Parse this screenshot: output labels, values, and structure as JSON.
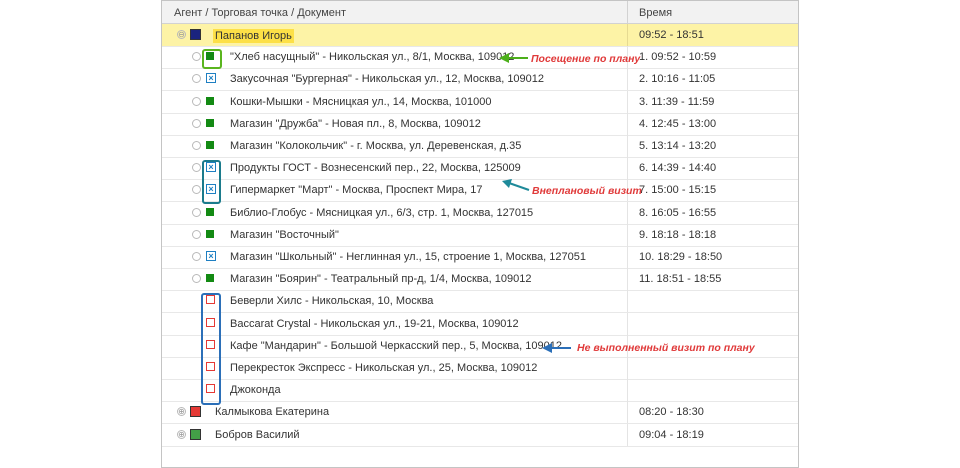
{
  "columns": {
    "name": "Агент / Торговая точка / Документ",
    "time": "Время"
  },
  "agents": [
    {
      "name": "Папанов Игорь",
      "time": "09:52 - 18:51",
      "color": "#1a237e",
      "expander": "⊖"
    },
    {
      "name": "Калмыкова Екатерина",
      "time": "08:20 - 18:30",
      "color": "#e53935",
      "expander": "⊕"
    },
    {
      "name": "Бобров Василий",
      "time": "09:04 - 18:19",
      "color": "#43a047",
      "expander": "⊕"
    }
  ],
  "visits": [
    {
      "text": "\"Хлеб насущный\"  -  Никольская ул., 8/1, Москва, 109012",
      "time": "1. 09:52 - 10:59",
      "status": "planned-done"
    },
    {
      "text": "Закусочная \"Бургерная\"  -  Никольская ул., 12, Москва, 109012",
      "time": "2. 10:16 - 11:05",
      "status": "unplanned"
    },
    {
      "text": "Кошки-Мышки  -  Мясницкая ул., 14, Москва, 101000",
      "time": "3. 11:39 - 11:59",
      "status": "planned-done"
    },
    {
      "text": "Магазин \"Дружба\"  -  Новая пл., 8, Москва, 109012",
      "time": "4. 12:45 - 13:00",
      "status": "planned-done"
    },
    {
      "text": "Магазин \"Колокольчик\"  -  г. Москва, ул. Деревенская, д.35",
      "time": "5. 13:14 - 13:20",
      "status": "planned-done"
    },
    {
      "text": "Продукты ГОСТ  -  Вознесенский пер., 22, Москва, 125009",
      "time": "6. 14:39 - 14:40",
      "status": "unplanned"
    },
    {
      "text": "Гипермаркет \"Март\"  -  Москва, Проспект Мира, 17",
      "time": "7. 15:00 - 15:15",
      "status": "unplanned"
    },
    {
      "text": "Библио-Глобус  -  Мясницкая ул., 6/3, стр. 1, Москва, 127015",
      "time": "8. 16:05 - 16:55",
      "status": "planned-done"
    },
    {
      "text": "Магазин \"Восточный\"",
      "time": "9. 18:18 - 18:18",
      "status": "planned-done"
    },
    {
      "text": "Магазин \"Школьный\"  -  Неглинная ул., 15, строение 1, Москва, 127051",
      "time": "10. 18:29 - 18:50",
      "status": "unplanned"
    },
    {
      "text": "Магазин \"Боярин\"  -  Театральный пр-д, 1/4, Москва, 109012",
      "time": "11. 18:51 - 18:55",
      "status": "planned-done"
    },
    {
      "text": "Беверли Хилс  -  Никольская, 10, Москва",
      "time": "",
      "status": "not-done"
    },
    {
      "text": "Baccarat Crystal  -  Никольская ул., 19-21, Москва, 109012",
      "time": "",
      "status": "not-done"
    },
    {
      "text": "Кафе \"Мандарин\"  -  Большой Черкасский пер., 5, Москва, 109012",
      "time": "",
      "status": "not-done"
    },
    {
      "text": "Перекресток Экспресс  -  Никольская ул., 25, Москва, 109012",
      "time": "",
      "status": "not-done"
    },
    {
      "text": "Джоконда",
      "time": "",
      "status": "not-done"
    }
  ],
  "annotations": {
    "planned": "Посещение по плану",
    "unplanned": "Внеплановый визит",
    "not_done": "Не выполненный визит по плану"
  },
  "colors": {
    "planned_marker": "#138a13",
    "unplanned_marker": "#1e7fc2",
    "not_done_marker": "#e53935",
    "selected_row": "#fdf3a6",
    "agent_highlight": "#fde047",
    "annotation_text": "#e03a3a",
    "arrow_green": "#4caf1a",
    "arrow_teal": "#1f8a9a",
    "arrow_blue": "#2b6fb8",
    "box_green": "#5ab51e",
    "box_teal": "#1b7b8c",
    "box_blue": "#2b6fb8"
  }
}
